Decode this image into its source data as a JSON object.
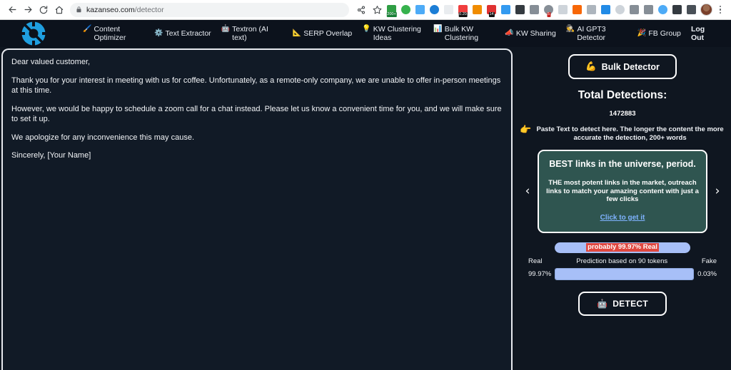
{
  "browser": {
    "back_icon": "back-arrow-icon",
    "forward_icon": "forward-arrow-icon",
    "reload_icon": "reload-icon",
    "home_icon": "home-icon",
    "lock_icon": "lock-icon",
    "url_domain": "kazanseo.com",
    "url_path": "/detector",
    "share_icon": "share-icon",
    "bookmark_icon": "star-icon",
    "menu_icon": "kebab-menu-icon",
    "profile_icon": "avatar",
    "extensions": [
      {
        "name": "extension-seo-meter",
        "color": "#2f9e44",
        "shape": "sq",
        "badge": "200+",
        "badge_class": "green"
      },
      {
        "name": "extension-puzzle-green",
        "color": "#37b24d",
        "shape": "ci",
        "badge": ""
      },
      {
        "name": "extension-diamond-blue",
        "color": "#4dabf7",
        "shape": "sq",
        "badge": ""
      },
      {
        "name": "extension-camera-ring",
        "color": "#1c7ed6",
        "shape": "ci",
        "badge": ""
      },
      {
        "name": "extension-zero-box",
        "color": "#e9ecef",
        "shape": "sq",
        "badge": ""
      },
      {
        "name": "extension-counter-red",
        "color": "#f03e3e",
        "shape": "sq",
        "badge": "0.20"
      },
      {
        "name": "extension-orange-bars",
        "color": "#f08c00",
        "shape": "sq",
        "badge": ""
      },
      {
        "name": "extension-calendar-red",
        "color": "#e03131",
        "shape": "sq",
        "badge": "14"
      },
      {
        "name": "extension-translate-blue",
        "color": "#339af0",
        "shape": "sq",
        "badge": ""
      },
      {
        "name": "extension-lightning",
        "color": "#343a40",
        "shape": "sq",
        "badge": ""
      },
      {
        "name": "extension-grey-text",
        "color": "#868e96",
        "shape": "sq",
        "badge": ""
      },
      {
        "name": "extension-globe-red",
        "color": "#868e96",
        "shape": "ci",
        "badge": "5",
        "badge_class": "red"
      },
      {
        "name": "extension-frame-white",
        "color": "#ced4da",
        "shape": "sq",
        "badge": ""
      },
      {
        "name": "extension-fox-orange",
        "color": "#f76707",
        "shape": "sq",
        "badge": ""
      },
      {
        "name": "extension-brackets",
        "color": "#adb5bd",
        "shape": "sq",
        "badge": ""
      },
      {
        "name": "extension-diamond-azure",
        "color": "#228be6",
        "shape": "sq",
        "badge": ""
      },
      {
        "name": "extension-circle-grey",
        "color": "#ced4da",
        "shape": "ci",
        "badge": ""
      },
      {
        "name": "extension-bird-grey",
        "color": "#868e96",
        "shape": "sq",
        "badge": ""
      },
      {
        "name": "extension-gear-grey",
        "color": "#868e96",
        "shape": "sq",
        "badge": ""
      },
      {
        "name": "extension-circle-l-blue",
        "color": "#4dabf7",
        "shape": "ci",
        "badge": ""
      },
      {
        "name": "extension-puzzle-dark",
        "color": "#343a40",
        "shape": "sq",
        "badge": ""
      },
      {
        "name": "extension-sidepanel",
        "color": "#495057",
        "shape": "sq",
        "badge": ""
      }
    ]
  },
  "nav": {
    "logo_name": "kazanseo-logo",
    "items": [
      {
        "icon": "🖌️",
        "icon_name": "brush-icon",
        "label": "Content Optimizer"
      },
      {
        "icon": "⚙️",
        "icon_name": "gear-icon",
        "label": "Text Extractor"
      },
      {
        "icon": "🤖",
        "icon_name": "robot-icon",
        "label": "Textron (AI text)"
      },
      {
        "icon": "📐",
        "icon_name": "ruler-icon",
        "label": "SERP Overlap"
      },
      {
        "icon": "💡",
        "icon_name": "lightbulb-icon",
        "label": "KW Clustering Ideas"
      },
      {
        "icon": "📊",
        "icon_name": "bar-chart-icon",
        "label": "Bulk KW Clustering"
      },
      {
        "icon": "📣",
        "icon_name": "megaphone-icon",
        "label": "KW Sharing"
      },
      {
        "icon": "🕵️",
        "icon_name": "detective-icon",
        "label": "AI GPT3 Detector"
      },
      {
        "icon": "🎉",
        "icon_name": "party-popper-icon",
        "label": "FB Group"
      }
    ],
    "logout_label": "Log Out"
  },
  "editor": {
    "paragraphs": [
      "Dear valued customer,",
      "Thank you for your interest in meeting with us for coffee. Unfortunately, as a remote-only company, we are unable to offer in-person meetings at this time.",
      "However, we would be happy to schedule a zoom call for a chat instead. Please let us know a convenient time for you, and we will make sure to set it up.",
      "We apologize for any inconvenience this may cause.",
      "Sincerely, [Your Name]"
    ]
  },
  "side": {
    "bulk_detector_label": "Bulk Detector",
    "bulk_detector_icon": "💪",
    "total_title": "Total Detections:",
    "total_count": "1472883",
    "paste_hint_icon": "👉",
    "paste_hint": "Paste Text to detect here. The longer the content the more accurate the detection, 200+ words",
    "carousel": {
      "prev_icon": "‹",
      "next_icon": "›",
      "title": "BEST links in the universe, period.",
      "body": "THE most potent links in the market, outreach links to match your amazing content with just a few clicks",
      "link_label": "Click to get it"
    },
    "prediction": {
      "pill_text": "probably 99.97% Real",
      "real_label": "Real",
      "fake_label": "Fake",
      "caption": "Prediction based on 90 tokens",
      "real_pct": "99.97%",
      "fake_pct": "0.03%",
      "real_value": 99.97,
      "fake_value": 0.03,
      "bar_color": "#a7bff7",
      "highlight_color": "#e0473f"
    },
    "detect_label": "DETECT",
    "detect_icon": "🤖"
  }
}
